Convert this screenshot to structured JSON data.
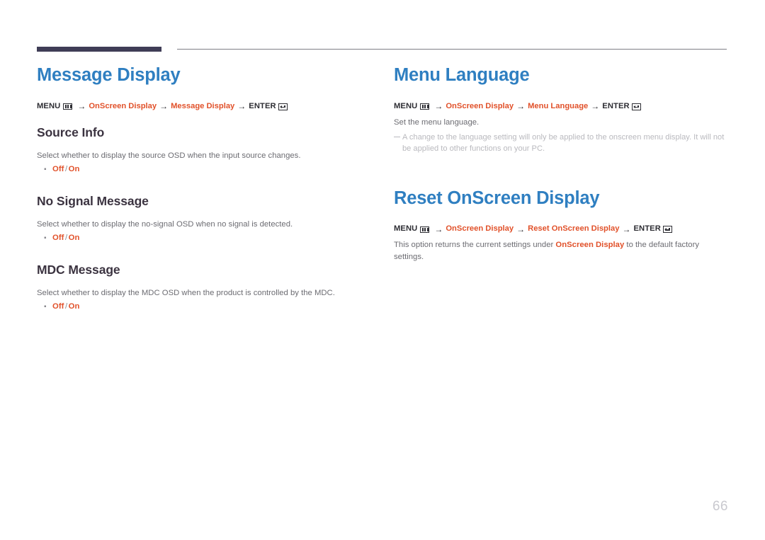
{
  "page": {
    "number": "66",
    "accent_blue": "#2f7fc1",
    "accent_orange": "#e1512a",
    "heading_dark": "#3b3340",
    "body_gray": "#6c6c72",
    "note_gray": "#b9b9be",
    "rule_dark": "#3f3d56",
    "rule_thin": "#7e7e86"
  },
  "icons": {
    "menu": "menu-icon",
    "enter": "enter-icon",
    "arrow": "→"
  },
  "left_column": {
    "section": {
      "title": "Message Display",
      "breadcrumb": {
        "menu_label": "MENU",
        "arrow": "→",
        "crumb1": "OnScreen Display",
        "crumb2": "Message Display",
        "enter_label": "ENTER"
      }
    },
    "subsections": [
      {
        "title": "Source Info",
        "body": "Select whether to display the source OSD when the input source changes.",
        "bullet": "▪",
        "option_off": "Off",
        "option_sep": "/",
        "option_on": "On"
      },
      {
        "title": "No Signal Message",
        "body": "Select whether to display the no-signal OSD when no signal is detected.",
        "bullet": "▪",
        "option_off": "Off",
        "option_sep": "/",
        "option_on": "On"
      },
      {
        "title": "MDC Message",
        "body": "Select whether to display the MDC OSD when the product is controlled by the MDC.",
        "bullet": "▪",
        "option_off": "Off",
        "option_sep": "/",
        "option_on": "On"
      }
    ]
  },
  "right_column": {
    "menu_language": {
      "title": "Menu Language",
      "breadcrumb": {
        "menu_label": "MENU",
        "arrow": "→",
        "crumb1": "OnScreen Display",
        "crumb2": "Menu Language",
        "enter_label": "ENTER"
      },
      "body": "Set the menu language.",
      "note": "A change to the language setting will only be applied to the onscreen menu display. It will not be applied to other functions on your PC."
    },
    "reset_osd": {
      "title": "Reset OnScreen Display",
      "breadcrumb": {
        "menu_label": "MENU",
        "arrow": "→",
        "crumb1": "OnScreen Display",
        "crumb2": "Reset OnScreen Display",
        "enter_label": "ENTER"
      },
      "body_before": "This option returns the current settings under ",
      "body_accent": "OnScreen Display",
      "body_after": " to the default factory settings."
    }
  }
}
